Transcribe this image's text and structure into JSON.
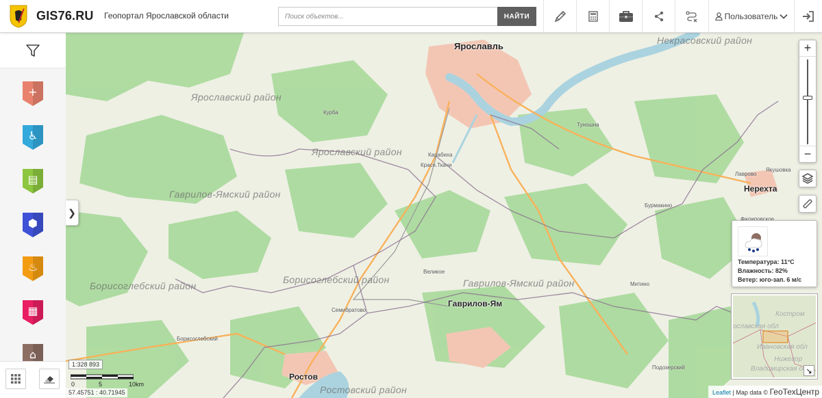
{
  "header": {
    "title": "GIS76.RU",
    "subtitle": "Геопортал Ярославской области",
    "logo_icon": "yaroslavl-coat-of-arms-icon",
    "search": {
      "placeholder": "Поиск объектов...",
      "value": "",
      "button_label": "НАЙТИ"
    },
    "tools": [
      {
        "name": "draw-tool-icon"
      },
      {
        "name": "calculator-icon"
      },
      {
        "name": "briefcase-icon"
      },
      {
        "name": "share-icon"
      },
      {
        "name": "route-clear-icon"
      }
    ],
    "user_label": "Пользователь",
    "logout_icon": "logout-icon"
  },
  "sidebar": {
    "filter_icon": "filter-icon",
    "layers": [
      {
        "name": "healthcare-layer-icon",
        "color": "#e8826e"
      },
      {
        "name": "accessibility-layer-icon",
        "color": "#33a9dc"
      },
      {
        "name": "education-layer-icon",
        "color": "#8dc63f"
      },
      {
        "name": "security-layer-icon",
        "color": "#3f51d6"
      },
      {
        "name": "agriculture-layer-icon",
        "color": "#f39c12"
      },
      {
        "name": "housing-layer-icon",
        "color": "#e91e63"
      },
      {
        "name": "culture-layer-icon",
        "color": "#8d6e63"
      }
    ],
    "bottom_buttons": [
      "grid-icon",
      "eraser-icon"
    ]
  },
  "map": {
    "districts": [
      {
        "label": "Ярославский район"
      },
      {
        "label": "Ярославский район"
      },
      {
        "label": "Гаврилов-Ямский район"
      },
      {
        "label": "Борисоглебский район"
      },
      {
        "label": "Борисоглебский район"
      },
      {
        "label": "Гаврилов-Ямский район"
      },
      {
        "label": "Некрасовский район"
      },
      {
        "label": "Ростовский район"
      }
    ],
    "cities": [
      {
        "label": "Ярославль"
      },
      {
        "label": "Гаврилов-Ям"
      },
      {
        "label": "Нерехта"
      },
      {
        "label": "Ростов"
      }
    ],
    "villages": [
      {
        "label": "Курба"
      },
      {
        "label": "Карабиха"
      },
      {
        "label": "Красн.Ткачи"
      },
      {
        "label": "Туношна"
      },
      {
        "label": "Лаврово"
      },
      {
        "label": "Якушовка"
      },
      {
        "label": "Бурмакино"
      },
      {
        "label": "Филиповское"
      },
      {
        "label": "Великое"
      },
      {
        "label": "Митино"
      },
      {
        "label": "Семибратово"
      },
      {
        "label": "Борисоглебский"
      },
      {
        "label": "Подозерский"
      }
    ],
    "scale_ratio": "1:328 893",
    "scale_ticks": [
      "0",
      "5",
      "10km"
    ],
    "coordinates": "57.45751 : 40.71945",
    "attribution_leaflet": "Leaflet",
    "attribution_data": "Map data ©",
    "attribution_brand": "ГеоТехЦентр",
    "colors": {
      "forest": "#a8d99a",
      "water": "#aad3df",
      "urban": "#f3c6b4",
      "road": "#f9b15a"
    }
  },
  "weather": {
    "icon": "rain-cloud-weather-icon",
    "temperature": "Температура: 11°C",
    "humidity": "Влажность: 82%",
    "wind": "Ветер: юго-зап. 6 м/с"
  },
  "minimap": {
    "labels": [
      "Костром",
      "ославская обл",
      "Ивановская обл",
      "Нижегор",
      "Владимирская об"
    ]
  }
}
